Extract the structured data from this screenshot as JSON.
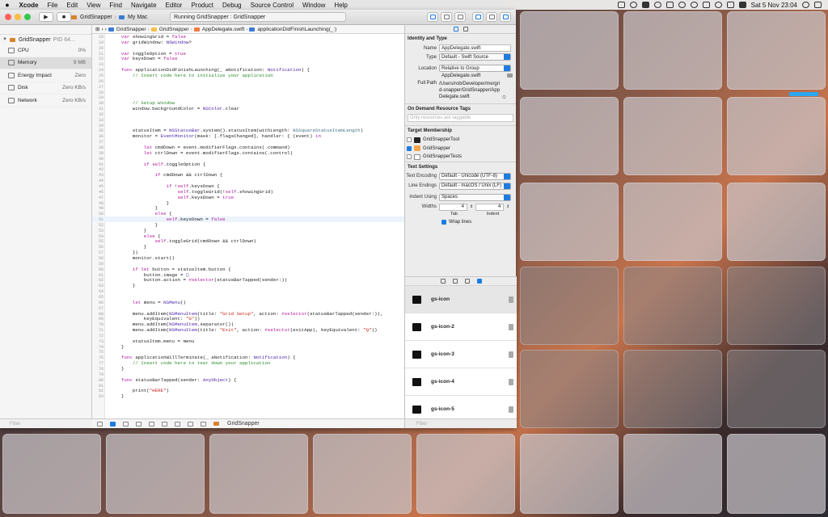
{
  "menubar": {
    "app": "Xcode",
    "items": [
      "File",
      "Edit",
      "View",
      "Find",
      "Navigate",
      "Editor",
      "Product",
      "Debug",
      "Source Control",
      "Window",
      "Help"
    ],
    "clock": "Sat 5 Nov  23:04"
  },
  "toolbar": {
    "scheme": "GridSnapper",
    "destination": "My Mac",
    "activity": "Running GridSnapper : GridSnapper"
  },
  "navigator": {
    "process": "GridSnapper",
    "pid": "PID 64...",
    "gauges": [
      {
        "label": "CPU",
        "value": "0%"
      },
      {
        "label": "Memory",
        "value": "9 MB"
      },
      {
        "label": "Energy Impact",
        "value": "Zero"
      },
      {
        "label": "Disk",
        "value": "Zero KB/s"
      },
      {
        "label": "Network",
        "value": "Zero KB/s"
      }
    ],
    "filter_placeholder": "Filter"
  },
  "jumpbar": {
    "crumbs": [
      "GridSnapper",
      "GridSnapper",
      "AppDelegate.swift",
      "applicationDidFinishLaunching(_:)"
    ]
  },
  "code": [
    {
      "n": "18",
      "html": "    <span class='kw'>var</span> showingGrid = <span class='kw'>false</span>"
    },
    {
      "n": "19",
      "html": "    <span class='kw'>var</span> gridWindow: <span class='ty'>NSWindow</span>?"
    },
    {
      "n": "20",
      "html": ""
    },
    {
      "n": "21",
      "html": "    <span class='kw'>var</span> toggleOption = <span class='kw'>true</span>"
    },
    {
      "n": "22",
      "html": "    <span class='kw'>var</span> keysDown = <span class='kw'>false</span>"
    },
    {
      "n": "23",
      "html": ""
    },
    {
      "n": "24",
      "html": "    <span class='kw'>func</span> applicationDidFinishLaunching(_ aNotification: <span class='ty'>Notification</span>) {"
    },
    {
      "n": "25",
      "html": "        <span class='cm'>// Insert code here to initialize your application</span>"
    },
    {
      "n": "26",
      "html": ""
    },
    {
      "n": "27",
      "html": ""
    },
    {
      "n": "28",
      "html": ""
    },
    {
      "n": "29",
      "html": ""
    },
    {
      "n": "30",
      "html": "        <span class='cm'>// Setup Window</span>"
    },
    {
      "n": "31",
      "html": "        window.backgroundColor = <span class='ty'>NSColor</span>.clear"
    },
    {
      "n": "32",
      "html": ""
    },
    {
      "n": "33",
      "html": ""
    },
    {
      "n": "34",
      "html": ""
    },
    {
      "n": "35",
      "html": "        statusItem = <span class='ty'>NSStatusBar</span>.system().statusItem(withLength: <span class='fn'>NSSquareStatusItemLength</span>)"
    },
    {
      "n": "36",
      "html": "        monitor = <span class='ty'>EventMonitor</span>(mask: [.flagsChanged], handler: { (event) <span class='kw'>in</span>"
    },
    {
      "n": "37",
      "html": ""
    },
    {
      "n": "38",
      "html": "            <span class='kw'>let</span> cmdDown = event.modifierFlags.contains(.command)"
    },
    {
      "n": "39",
      "html": "            <span class='kw'>let</span> ctrlDown = event.modifierFlags.contains(.control)"
    },
    {
      "n": "40",
      "html": ""
    },
    {
      "n": "41",
      "html": "            <span class='kw'>if</span> <span class='kw'>self</span>.toggleOption {"
    },
    {
      "n": "42",
      "html": ""
    },
    {
      "n": "43",
      "html": "                <span class='kw'>if</span> cmdDown &amp;&amp; ctrlDown {"
    },
    {
      "n": "44",
      "html": ""
    },
    {
      "n": "45",
      "html": "                    <span class='kw'>if</span> !<span class='kw'>self</span>.keysDown {"
    },
    {
      "n": "46",
      "html": "                        <span class='kw'>self</span>.toggleGrid(!<span class='kw'>self</span>.showingGrid)"
    },
    {
      "n": "47",
      "html": "                        <span class='kw'>self</span>.keysDown = <span class='kw'>true</span>"
    },
    {
      "n": "48",
      "html": "                    }"
    },
    {
      "n": "49",
      "html": "                }"
    },
    {
      "n": "50",
      "html": "                <span class='kw'>else</span> {"
    },
    {
      "n": "51",
      "html": "                    <span class='kw'>self</span>.keysDown = <span class='kw'>false</span>"
    },
    {
      "n": "52",
      "html": "                }"
    },
    {
      "n": "53",
      "html": "            }"
    },
    {
      "n": "54",
      "html": "            <span class='kw'>else</span> {"
    },
    {
      "n": "55",
      "html": "                <span class='kw'>self</span>.toggleGrid(cmdDown &amp;&amp; ctrlDown)"
    },
    {
      "n": "56",
      "html": "            }"
    },
    {
      "n": "57",
      "html": "        })"
    },
    {
      "n": "58",
      "html": "        monitor.start()"
    },
    {
      "n": "59",
      "html": ""
    },
    {
      "n": "60",
      "html": "        <span class='kw'>if let</span> button = statusItem.button {"
    },
    {
      "n": "61",
      "html": "            button.image = <span class='ty'>▢</span>"
    },
    {
      "n": "62",
      "html": "            button.action = <span class='kw'>#selector</span>(statusBarTapped(sender:))"
    },
    {
      "n": "63",
      "html": "        }"
    },
    {
      "n": "64",
      "html": ""
    },
    {
      "n": "65",
      "html": ""
    },
    {
      "n": "66",
      "html": "        <span class='kw'>let</span> menu = <span class='ty'>NSMenu</span>()"
    },
    {
      "n": "67",
      "html": ""
    },
    {
      "n": "68",
      "html": "        menu.addItem(<span class='ty'>NSMenuItem</span>(title: <span class='st'>\"Grid Setup\"</span>, action: <span class='kw'>#selector</span>(statusBarTapped(sender:)),"
    },
    {
      "n": "69",
      "html": "            keyEquivalent: <span class='st'>\"G\"</span>))"
    },
    {
      "n": "70",
      "html": "        menu.addItem(<span class='ty'>NSMenuItem</span>.separator())"
    },
    {
      "n": "71",
      "html": "        menu.addItem(<span class='ty'>NSMenuItem</span>(title: <span class='st'>\"Exit\"</span>, action: <span class='kw'>#selector</span>(exitApp), keyEquivalent: <span class='st'>\"Q\"</span>))"
    },
    {
      "n": "72",
      "html": ""
    },
    {
      "n": "73",
      "html": "        statusItem.menu = menu"
    },
    {
      "n": "74",
      "html": "    }"
    },
    {
      "n": "75",
      "html": ""
    },
    {
      "n": "76",
      "html": "    <span class='kw'>func</span> applicationWillTerminate(_ aNotification: <span class='ty'>Notification</span>) {"
    },
    {
      "n": "77",
      "html": "        <span class='cm'>// Insert code here to tear down your application</span>"
    },
    {
      "n": "78",
      "html": "    }"
    },
    {
      "n": "79",
      "html": ""
    },
    {
      "n": "80",
      "html": "    <span class='kw'>func</span> statusBarTapped(sender: <span class='ty'>AnyObject</span>) {"
    },
    {
      "n": "81",
      "html": ""
    },
    {
      "n": "82",
      "html": "        print(<span class='st'>\"HERE\"</span>)"
    },
    {
      "n": "83",
      "html": "    }"
    }
  ],
  "debugbar": {
    "target": "GridSnapper"
  },
  "inspector": {
    "identity_title": "Identity and Type",
    "name_label": "Name",
    "name_value": "AppDelegate.swift",
    "type_label": "Type",
    "type_value": "Default - Swift Source",
    "location_label": "Location",
    "location_value": "Relative to Group",
    "location_file": "AppDelegate.swift",
    "fullpath_label": "Full Path",
    "fullpath_value": "/Users/rob/Developer/me/grid-snapper/GridSnapper/AppDelegate.swift",
    "odr_title": "On Demand Resource Tags",
    "odr_placeholder": "Only resources are taggable",
    "target_title": "Target Membership",
    "targets": [
      {
        "label": "GridSnapperTool",
        "checked": false
      },
      {
        "label": "GridSnapper",
        "checked": true
      },
      {
        "label": "GridSnapperTests",
        "checked": false
      }
    ],
    "text_title": "Text Settings",
    "encoding_label": "Text Encoding",
    "encoding_value": "Default - Unicode (UTF-8)",
    "endings_label": "Line Endings",
    "endings_value": "Default - macOS / Unix (LF)",
    "indent_label": "Indent Using",
    "indent_value": "Spaces",
    "widths_label": "Widths",
    "tab_value": "4",
    "indent_width_value": "4",
    "tab_label": "Tab",
    "indent_sub_label": "Indent",
    "wrap_label": "Wrap lines"
  },
  "library": {
    "items": [
      "gs-icon",
      "gs-icon-2",
      "gs-icon-3",
      "gs-icon-4",
      "gs-icon-5"
    ],
    "filter_placeholder": "Filter"
  }
}
